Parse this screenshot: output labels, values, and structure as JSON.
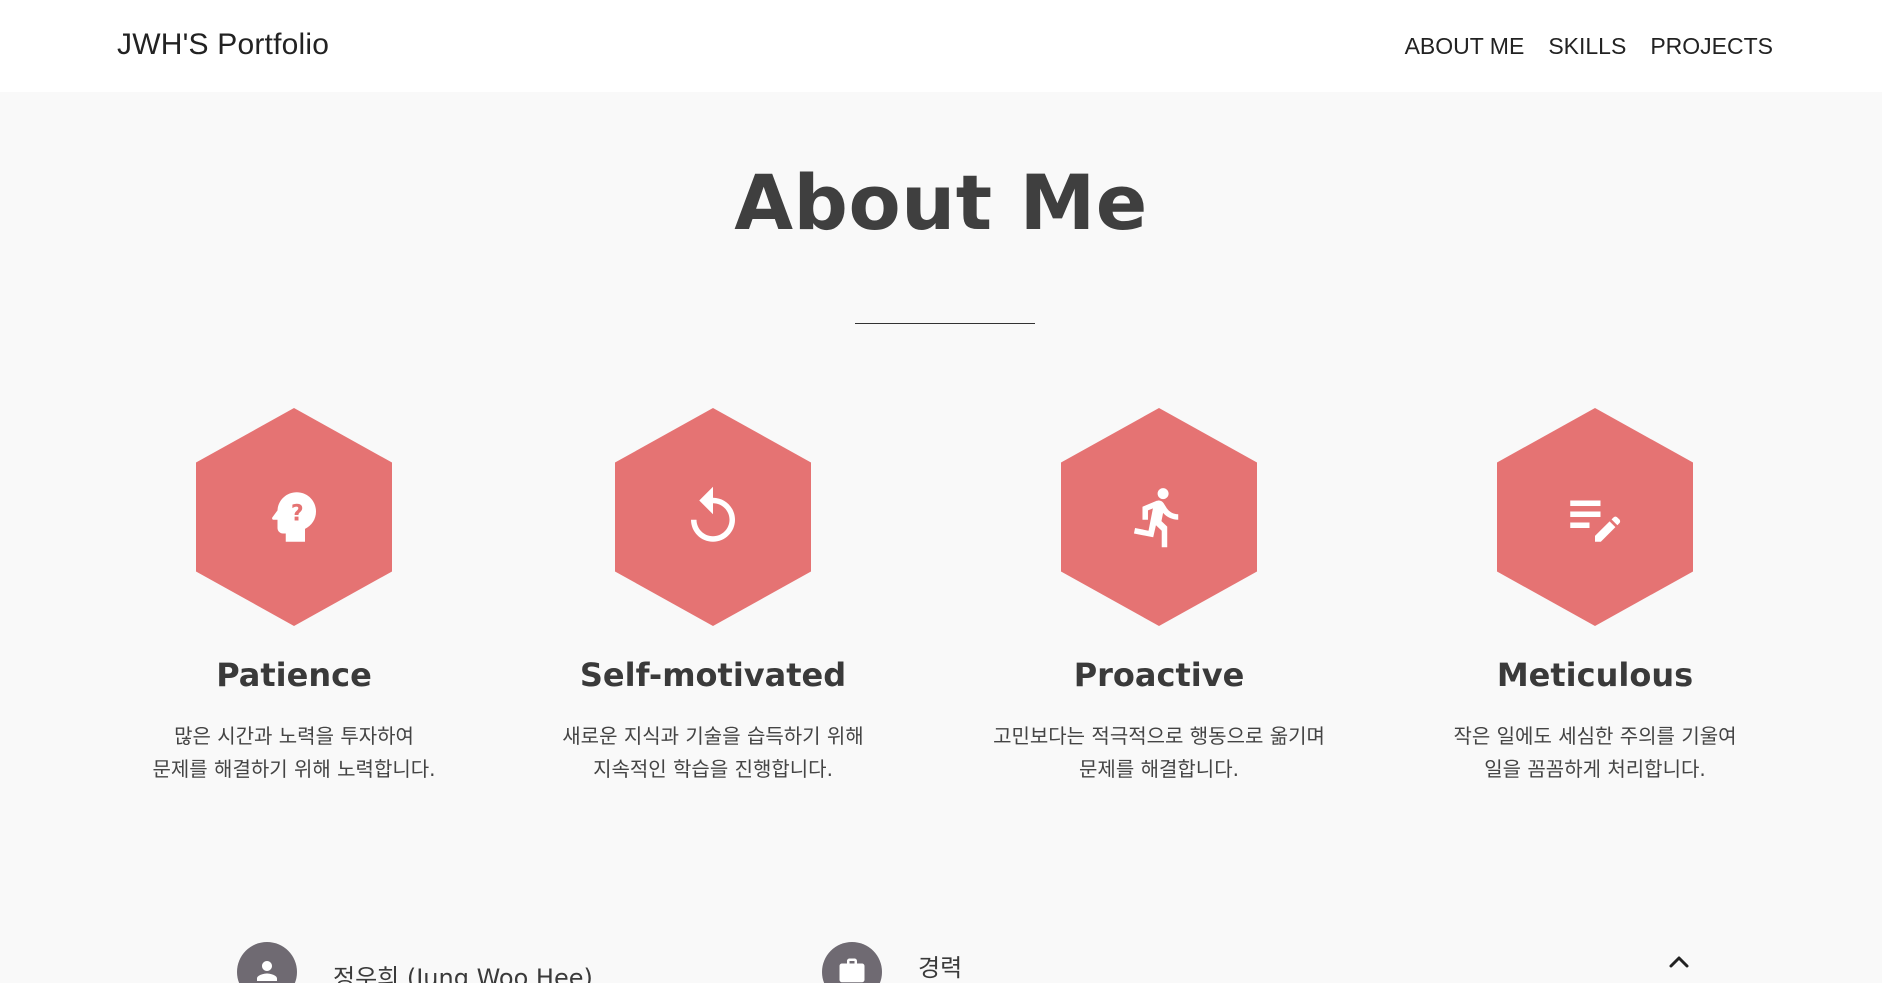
{
  "header": {
    "brand": "JWH'S Portfolio",
    "nav": [
      {
        "label": "ABOUT ME"
      },
      {
        "label": "SKILLS"
      },
      {
        "label": "PROJECTS"
      }
    ]
  },
  "about": {
    "title": "About Me",
    "traits": [
      {
        "icon": "psychology-head-icon",
        "title": "Patience",
        "desc_line1": "많은 시간과 노력을 투자하여",
        "desc_line2": "문제를 해결하기 위해 노력합니다."
      },
      {
        "icon": "refresh-icon",
        "title": "Self-motivated",
        "desc_line1": "새로운 지식과 기술을 습득하기 위해",
        "desc_line2": "지속적인 학습을 진행합니다."
      },
      {
        "icon": "running-person-icon",
        "title": "Proactive",
        "desc_line1": "고민보다는 적극적으로 행동으로 옮기며",
        "desc_line2": "문제를 해결합니다."
      },
      {
        "icon": "edit-note-icon",
        "title": "Meticulous",
        "desc_line1": "작은 일에도 세심한 주의를 기울여",
        "desc_line2": "일을 꼼꼼하게 처리합니다."
      }
    ],
    "accent_color": "#e57373"
  },
  "info": {
    "name": "정우희 (Jung Woo Hee)",
    "career_label": "경력",
    "name_icon": "person-icon",
    "career_icon": "briefcase-icon",
    "collapse_icon": "chevron-up-icon"
  }
}
